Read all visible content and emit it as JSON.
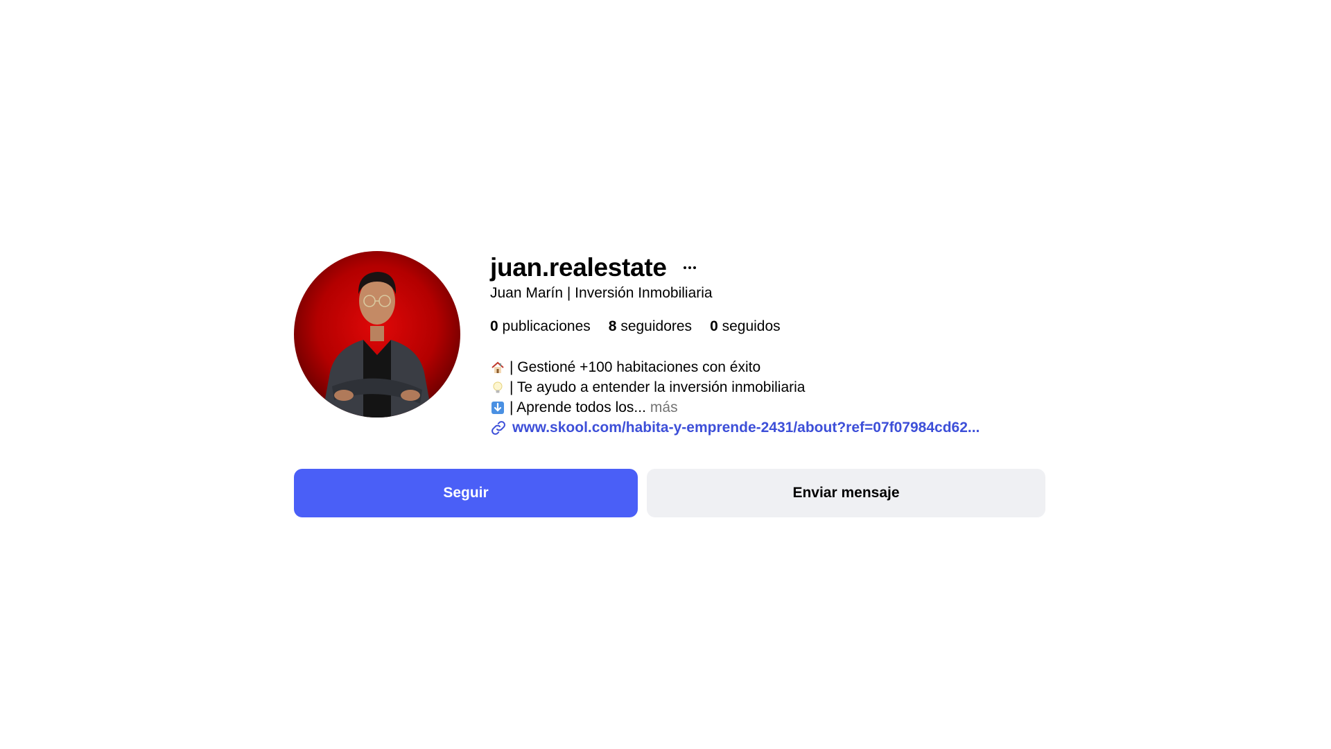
{
  "profile": {
    "username": "juan.realestate",
    "full_name": "Juan Marín | Inversión Inmobiliaria",
    "stats": {
      "posts_count": "0",
      "posts_label": "publicaciones",
      "followers_count": "8",
      "followers_label": "seguidores",
      "following_count": "0",
      "following_label": "seguidos"
    },
    "bio": {
      "line1": "| Gestioné +100 habitaciones con éxito",
      "line1_icon": "house-icon",
      "line2": "| Te ayudo a entender la inversión inmobiliaria",
      "line2_icon": "lightbulb-icon",
      "line3": "| Aprende todos los...",
      "line3_icon": "down-arrow-icon",
      "more_label": "más"
    },
    "link": {
      "text": "www.skool.com/habita-y-emprende-2431/about?ref=07f07984cd62...",
      "icon": "link-icon"
    }
  },
  "actions": {
    "follow_label": "Seguir",
    "message_label": "Enviar mensaje"
  },
  "colors": {
    "primary": "#4a5ff7",
    "link": "#3d4fd8",
    "secondary_bg": "#eff0f3",
    "muted_text": "#737373",
    "avatar_bg": "#b30000"
  }
}
